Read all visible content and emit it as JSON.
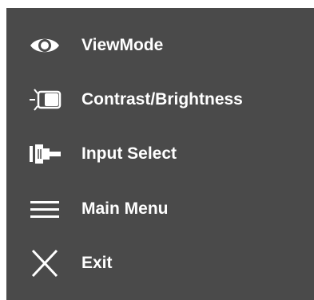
{
  "osd_menu": {
    "colors": {
      "panel_background": "#4a4a4a",
      "foreground": "#ffffff"
    },
    "items": [
      {
        "label": "ViewMode",
        "icon": "eye-icon"
      },
      {
        "label": "Contrast/Brightness",
        "icon": "brightness-icon"
      },
      {
        "label": "Input Select",
        "icon": "input-connector-icon"
      },
      {
        "label": "Main Menu",
        "icon": "menu-lines-icon"
      },
      {
        "label": "Exit",
        "icon": "close-icon"
      }
    ]
  }
}
